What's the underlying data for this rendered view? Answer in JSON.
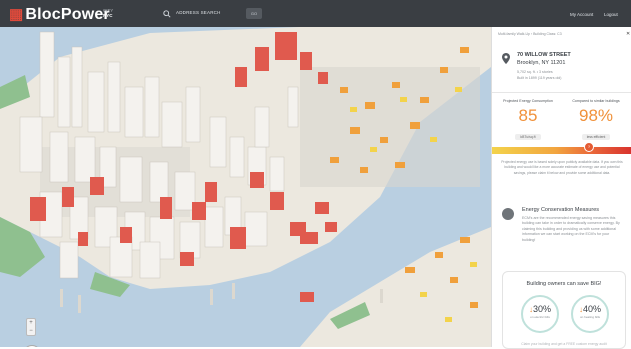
{
  "header": {
    "brand": "BlocPower",
    "city_label": "CITY",
    "city_value": "NYC",
    "search_label": "ADDRESS SEARCH",
    "search_button": "GO",
    "my_account": "My Account",
    "logout": "Logout"
  },
  "map": {
    "zoom_in": "+",
    "zoom_out": "−"
  },
  "panel": {
    "breadcrumb": "Multi-family Walk-Up › Building Class: C3",
    "close": "✕",
    "address_line1": "70 WILLOW STREET",
    "address_line2": "Brooklyn, NY 11201",
    "meta_line1": "5,702 sq. ft. • 3 stories",
    "meta_line2": "Built in 1899 (119 years old)",
    "stats": [
      {
        "label": "Projected Energy Consumption",
        "value": "85",
        "unit": "kBTu/sq.ft"
      },
      {
        "label": "Compared to similar buildings",
        "value": "98%",
        "unit": "less efficient"
      }
    ],
    "marker_symbol": "?",
    "note": "Projected energy use is based solely upon publicly available data. If you own this building and would like a more accurate estimate of energy use and potential savings, please claim it below and provide some additional data.",
    "ecm": {
      "title": "Energy Conservation Measures",
      "text": "ECM's are the recommended energy saving measures this building can take in order to dramatically conserve energy. By claiming this building and providing us with some additional information we can start working on the ECM's for your building!"
    },
    "savings": {
      "title": "Building owners can save BIG!",
      "items": [
        {
          "pct": "30%",
          "label": "on electric bills"
        },
        {
          "pct": "40%",
          "label": "on heating bills"
        }
      ],
      "footer": "Claim your building and get a FREE custom energy audit"
    }
  },
  "colors": {
    "header_bg": "#3a3e43",
    "brand_accent": "#e04a3b",
    "stat_value": "#f0913a",
    "water": "#b9cfe1",
    "park": "#8fc08f"
  }
}
